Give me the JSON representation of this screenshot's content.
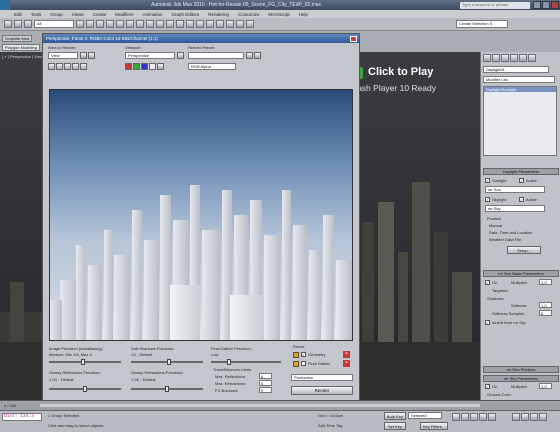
{
  "window": {
    "title": "Autodesk 3ds Max 2010 - Hot-for-Resale   05_Scene_FG_City_TEdP_02.max",
    "search_placeholder": "Type a keyword or phrase"
  },
  "menu": [
    "Edit",
    "Tools",
    "Group",
    "Views",
    "Create",
    "Modifiers",
    "Animation",
    "Graph Editors",
    "Rendering",
    "Customize",
    "MAXScript",
    "Help"
  ],
  "toolbar": {
    "selection_filter": "All",
    "named_selection": "Create Selection S"
  },
  "ribbon": {
    "tab_graphite": "Graphite Mod",
    "tab_polygon": "Polygon Modeling"
  },
  "viewport": {
    "label": "[ + ] Perspective [ Smooth + Highlights ]"
  },
  "render_frame": {
    "title": "Perspective, frame 0, RGBA Color 16 Bits/Channel (1:1)",
    "area_to_render_label": "Area to Render:",
    "area_to_render_value": "View",
    "viewport_label": "Viewport:",
    "viewport_value": "Perspective",
    "render_preset_label": "Render Preset:",
    "render_preset_value": "",
    "channel_value": "RGB Alpha",
    "image_precision_label": "Image Precision (Antialiasing):",
    "image_precision_value": "Medium: Min 1/4, Max 4",
    "soft_shadows_label": "Soft Shadows Precision:",
    "soft_shadows_value": "1X - Default",
    "final_gather_label": "Final Gather Precision:",
    "final_gather_value": "Low",
    "reuse_label": "Reuse",
    "geometry_label": "Geometry",
    "final_gather_chk_label": "Final Gather",
    "glossy_reflections_label": "Glossy Reflections Precision:",
    "glossy_reflections_value": "1.0X - Default",
    "glossy_refractions_label": "Glossy Refractions Precision:",
    "glossy_refractions_value": "1.0X - Default",
    "trace_label": "Trace/Bounces Limits",
    "max_reflections_label": "Max. Reflections:",
    "max_reflections_value": "6",
    "max_refractions_label": "Max. Refractions:",
    "max_refractions_value": "6",
    "fg_bounces_label": "FG Bounces:",
    "fg_bounces_value": "0",
    "mode_value": "Production",
    "render_button": "Render"
  },
  "flash": {
    "cta": "Click to Play",
    "sub": "Flash Player 10 Ready"
  },
  "command_panel": {
    "object_name": "Daylight01",
    "modifier_list": "Modifier List",
    "stack_item": "Daylight/Sunlight",
    "daylight_params": "Daylight Parameters",
    "sunlight_label": "Sunlight",
    "active_label": "Active",
    "sunlight_type": "mr Sun",
    "skylight_label": "Skylight",
    "skylight_type": "mr Sky",
    "position_label": "Position",
    "pos_manual": "Manual",
    "pos_date": "Date, Time and Location",
    "pos_weather": "Weather Data File",
    "setup_button": "Setup...",
    "sun_basic": "mr Sun Basic Parameters",
    "on_label": "On",
    "multiplier_label": "Multiplier",
    "multiplier_value": "1.0",
    "targeted_label": "Targeted",
    "shadows_label": "Shadows",
    "softness_label": "Softness",
    "softness_value": "1.0",
    "softness_samples_label": "Softness Samples",
    "softness_samples_value": "8",
    "inherit_label": "Inherit from mr Sky",
    "sky_params": "mr Sky Parameters",
    "sun_photons": "mr Sun Photons",
    "sky_multiplier_value": "1.0",
    "ground_color_label": "Ground Color"
  },
  "timeline": {
    "frame": "0 / 100"
  },
  "status": {
    "prompt": "Dist: 134.3",
    "selection": "1 Group Selected",
    "hint": "Click and drag to select objects",
    "grid": "Grid = 10.0cm",
    "auto_key": "Auto Key",
    "selected": "Selected",
    "set_key": "Set Key",
    "key_filters": "Key Filters...",
    "add_time_tag": "Add Time Tag"
  }
}
